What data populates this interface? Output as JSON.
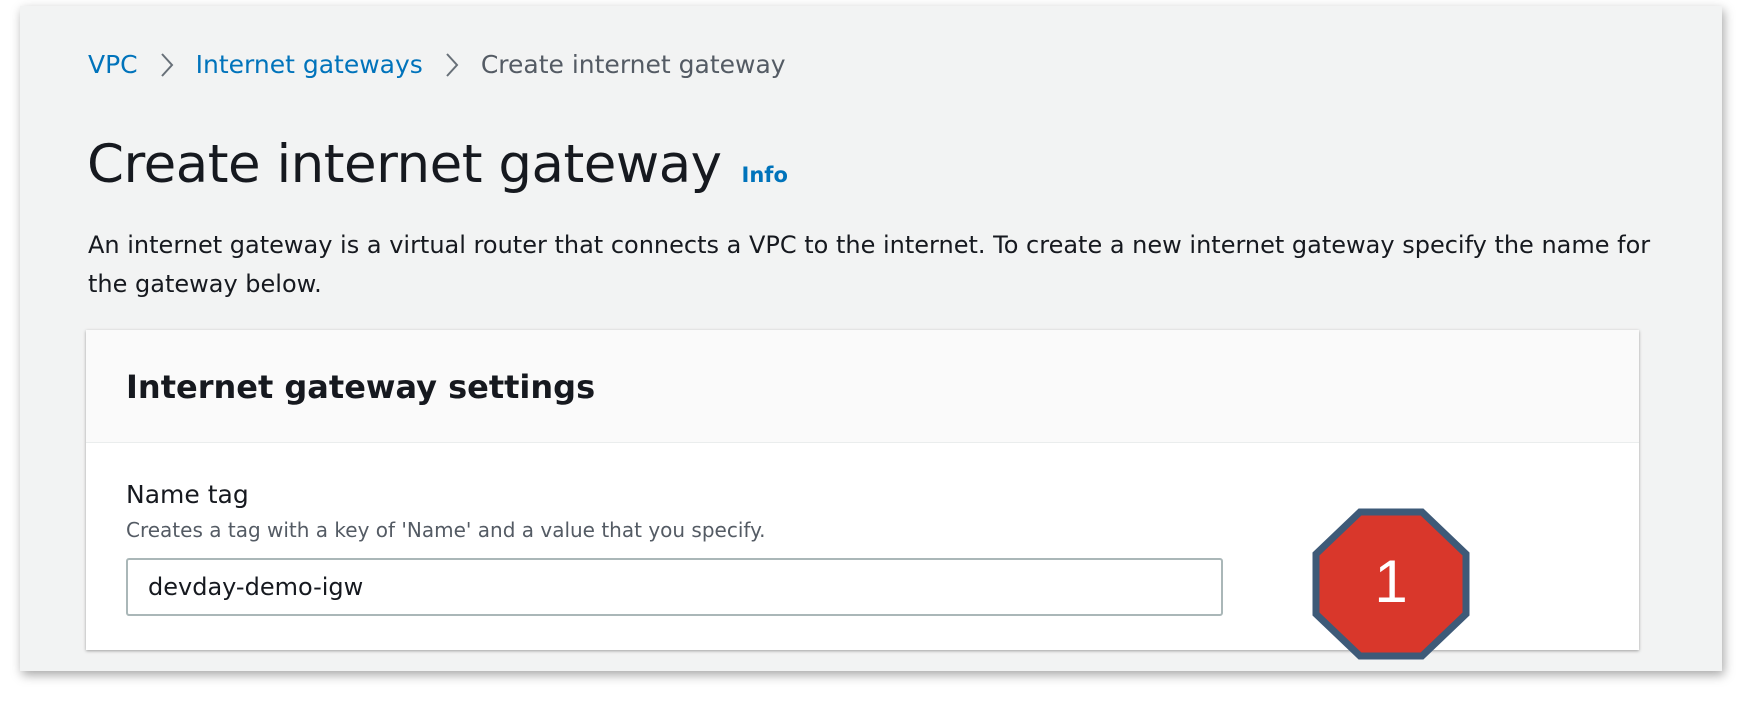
{
  "breadcrumb": {
    "items": [
      {
        "label": "VPC"
      },
      {
        "label": "Internet gateways"
      },
      {
        "label": "Create internet gateway"
      }
    ]
  },
  "header": {
    "title": "Create internet gateway",
    "info_label": "Info"
  },
  "description": "An internet gateway is a virtual router that connects a VPC to the internet. To create a new internet gateway specify the name for the gateway below.",
  "settings_panel": {
    "title": "Internet gateway settings",
    "name_tag": {
      "label": "Name tag",
      "description": "Creates a tag with a key of 'Name' and a value that you specify.",
      "value": "devday-demo-igw"
    }
  },
  "annotation": {
    "step_number": "1",
    "color": "#d9372b",
    "border_color": "#3e5a78"
  },
  "colors": {
    "link": "#0073bb",
    "background": "#f2f3f3",
    "text": "#16191f"
  }
}
